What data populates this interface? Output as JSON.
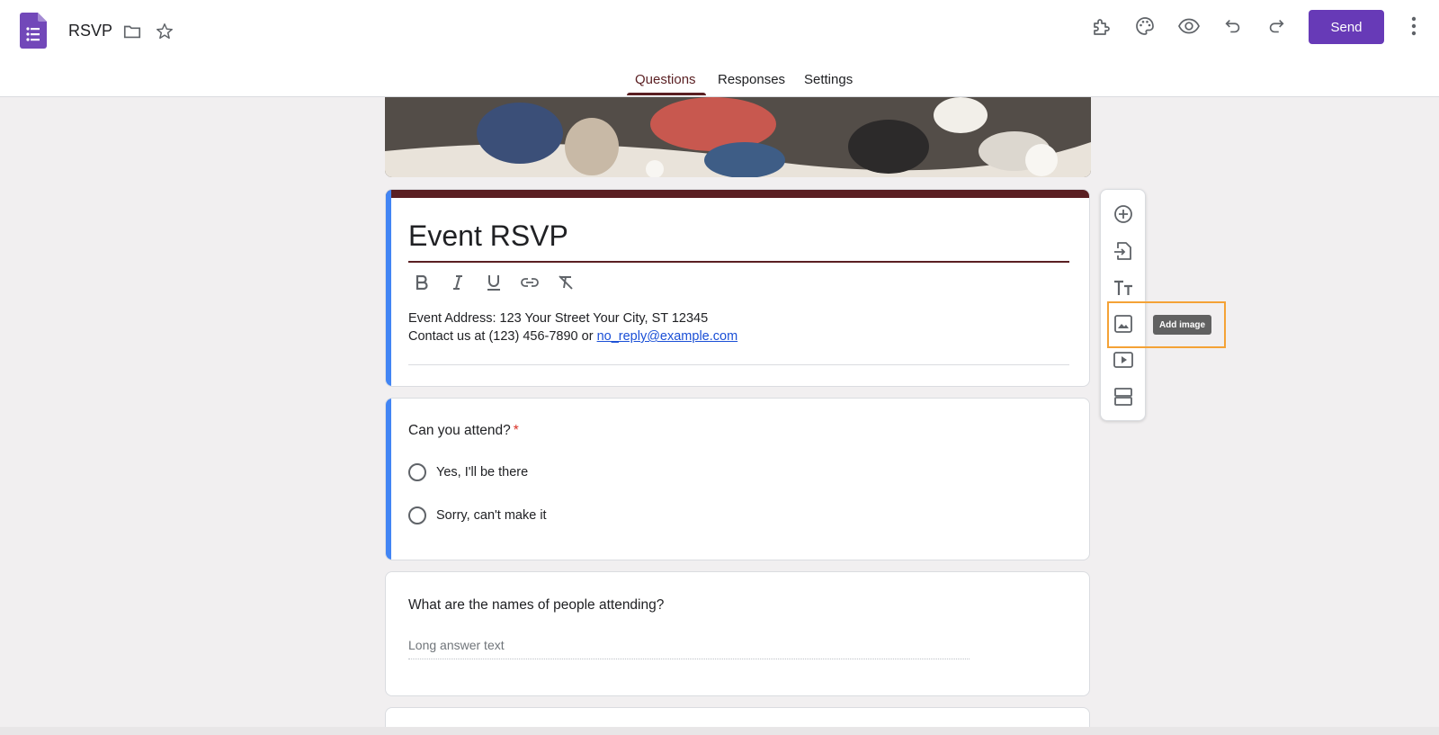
{
  "header": {
    "doc_title": "RSVP",
    "send_label": "Send",
    "colors": {
      "brand": "#673ab7",
      "theme": "#5a1f22",
      "accent": "#4285f4"
    },
    "icons": [
      "forms-logo-icon",
      "folder-icon",
      "star-icon",
      "addon-puzzle-icon",
      "palette-icon",
      "preview-eye-icon",
      "undo-icon",
      "redo-icon",
      "more-vert-icon"
    ]
  },
  "tabs": [
    {
      "label": "Questions",
      "active": true
    },
    {
      "label": "Responses",
      "active": false
    },
    {
      "label": "Settings",
      "active": false
    }
  ],
  "form": {
    "title": "Event RSVP",
    "format_icons": [
      "bold-icon",
      "italic-icon",
      "underline-icon",
      "link-icon",
      "clear-format-icon"
    ],
    "description_line1": "Event Address: 123 Your Street Your City, ST 12345",
    "description_line2_prefix": "Contact us at (123) 456-7890 or ",
    "description_email": "no_reply@example.com"
  },
  "questions": [
    {
      "text": "Can you attend?",
      "required_mark": "*",
      "options": [
        "Yes,  I'll be there",
        "Sorry, can't make it"
      ]
    },
    {
      "text": "What are the names of people attending?",
      "placeholder": "Long answer text"
    }
  ],
  "floating_toolbar": {
    "icons": [
      "add-question-icon",
      "import-questions-icon",
      "add-title-icon",
      "add-image-icon",
      "add-video-icon",
      "add-section-icon"
    ],
    "tooltip": "Add image"
  }
}
